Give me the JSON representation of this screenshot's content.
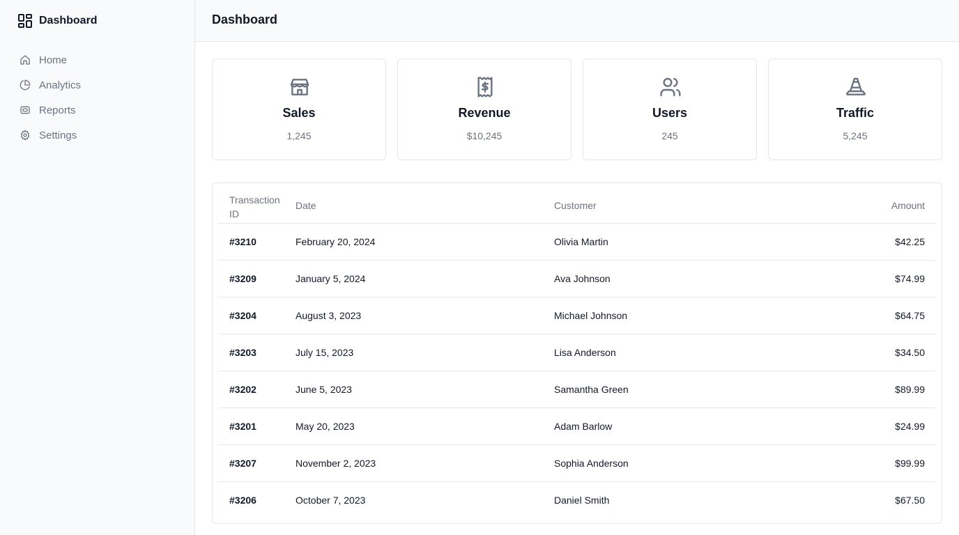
{
  "sidebar": {
    "brand": "Dashboard",
    "items": [
      {
        "label": "Home",
        "icon": "home-icon"
      },
      {
        "label": "Analytics",
        "icon": "pie-chart-icon"
      },
      {
        "label": "Reports",
        "icon": "reports-icon"
      },
      {
        "label": "Settings",
        "icon": "gear-icon"
      }
    ]
  },
  "header": {
    "title": "Dashboard"
  },
  "stats": [
    {
      "label": "Sales",
      "value": "1,245",
      "icon": "store-icon"
    },
    {
      "label": "Revenue",
      "value": "$10,245",
      "icon": "receipt-dollar-icon"
    },
    {
      "label": "Users",
      "value": "245",
      "icon": "users-icon"
    },
    {
      "label": "Traffic",
      "value": "5,245",
      "icon": "traffic-cone-icon"
    }
  ],
  "table": {
    "headers": [
      "Transaction ID",
      "Date",
      "Customer",
      "Amount"
    ],
    "rows": [
      {
        "id": "#3210",
        "date": "February 20, 2024",
        "customer": "Olivia Martin",
        "amount": "$42.25"
      },
      {
        "id": "#3209",
        "date": "January 5, 2024",
        "customer": "Ava Johnson",
        "amount": "$74.99"
      },
      {
        "id": "#3204",
        "date": "August 3, 2023",
        "customer": "Michael Johnson",
        "amount": "$64.75"
      },
      {
        "id": "#3203",
        "date": "July 15, 2023",
        "customer": "Lisa Anderson",
        "amount": "$34.50"
      },
      {
        "id": "#3202",
        "date": "June 5, 2023",
        "customer": "Samantha Green",
        "amount": "$89.99"
      },
      {
        "id": "#3201",
        "date": "May 20, 2023",
        "customer": "Adam Barlow",
        "amount": "$24.99"
      },
      {
        "id": "#3207",
        "date": "November 2, 2023",
        "customer": "Sophia Anderson",
        "amount": "$99.99"
      },
      {
        "id": "#3206",
        "date": "October 7, 2023",
        "customer": "Daniel Smith",
        "amount": "$67.50"
      }
    ]
  },
  "colors": {
    "sidebar_bg": "#f9fafb",
    "border": "#e5e7eb",
    "text": "#111827",
    "muted": "#6b7280"
  }
}
